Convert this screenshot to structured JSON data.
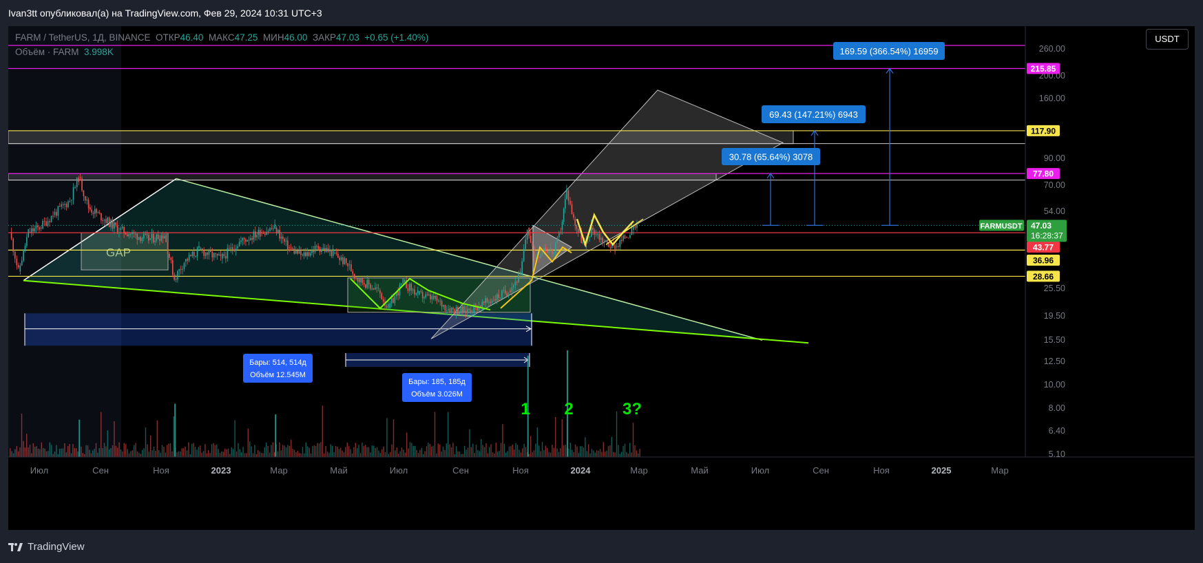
{
  "header": {
    "publish_info": "Ivan3tt опубликовал(а) на TradingView.com, Фев 29, 2024 10:31 UTC+3"
  },
  "legend": {
    "symbol_line": "FARM / TetherUS, 1Д, BINANCE",
    "open_label": "ОТКР",
    "open": "46.40",
    "high_label": "МАКС",
    "high": "47.25",
    "low_label": "МИН",
    "low": "46.00",
    "close_label": "ЗАКР",
    "close": "47.03",
    "change": "+0.65 (+1.40%)",
    "volume_label": "Объём · FARM",
    "volume": "3.998K"
  },
  "currency_button": "USDT",
  "footer": {
    "brand": "TradingView"
  },
  "colors": {
    "magenta": "#e91eeb",
    "yellow": "#f5e44a",
    "red": "#f23645",
    "green": "#26a69a",
    "blue_box": "#2962ff",
    "label_blue": "#1976d2",
    "lime": "#7cfc00",
    "annotation_green": "#00e600"
  },
  "chart_data": {
    "type": "candlestick",
    "symbol": "FARM / TetherUS",
    "interval": "1Д",
    "exchange": "BINANCE",
    "scale": "log",
    "ylim": [
      5.1,
      270
    ],
    "yticks": [
      "260.00",
      "200.00",
      "160.00",
      "90.00",
      "70.00",
      "54.00",
      "25.50",
      "19.50",
      "15.50",
      "12.50",
      "10.00",
      "8.00",
      "6.40",
      "5.10"
    ],
    "xticks": [
      "Июл",
      "Сен",
      "Ноя",
      "2023",
      "Мар",
      "Май",
      "Июл",
      "Сен",
      "Ноя",
      "2024",
      "Мар",
      "Май",
      "Июл",
      "Сен",
      "Ноя",
      "2025",
      "Мар"
    ],
    "price_path": [
      [
        "2022-06-01",
        44
      ],
      [
        "2022-06-10",
        30
      ],
      [
        "2022-06-20",
        44
      ],
      [
        "2022-07-01",
        46
      ],
      [
        "2022-07-15",
        52
      ],
      [
        "2022-08-01",
        60
      ],
      [
        "2022-08-10",
        75
      ],
      [
        "2022-08-20",
        56
      ],
      [
        "2022-09-05",
        50
      ],
      [
        "2022-09-20",
        45
      ],
      [
        "2022-10-05",
        43
      ],
      [
        "2022-10-20",
        41
      ],
      [
        "2022-11-05",
        43
      ],
      [
        "2022-11-15",
        28
      ],
      [
        "2022-11-25",
        33
      ],
      [
        "2022-12-10",
        37
      ],
      [
        "2023-01-01",
        34
      ],
      [
        "2023-01-20",
        40
      ],
      [
        "2023-02-10",
        44
      ],
      [
        "2023-02-25",
        46
      ],
      [
        "2023-03-10",
        38
      ],
      [
        "2023-03-25",
        35
      ],
      [
        "2023-04-10",
        38
      ],
      [
        "2023-04-25",
        36
      ],
      [
        "2023-05-10",
        32
      ],
      [
        "2023-05-20",
        28
      ],
      [
        "2023-06-10",
        25
      ],
      [
        "2023-06-20",
        21
      ],
      [
        "2023-07-05",
        27
      ],
      [
        "2023-07-20",
        24
      ],
      [
        "2023-08-05",
        23
      ],
      [
        "2023-08-20",
        21
      ],
      [
        "2023-09-05",
        20.5
      ],
      [
        "2023-09-20",
        21.5
      ],
      [
        "2023-10-05",
        23
      ],
      [
        "2023-10-20",
        25
      ],
      [
        "2023-11-01",
        29
      ],
      [
        "2023-11-08",
        46
      ],
      [
        "2023-11-15",
        34
      ],
      [
        "2023-11-25",
        38
      ],
      [
        "2023-12-05",
        36
      ],
      [
        "2023-12-12",
        45
      ],
      [
        "2023-12-18",
        66
      ],
      [
        "2023-12-25",
        50
      ],
      [
        "2024-01-05",
        38
      ],
      [
        "2024-01-12",
        46
      ],
      [
        "2024-01-25",
        40
      ],
      [
        "2024-02-05",
        38
      ],
      [
        "2024-02-15",
        42
      ],
      [
        "2024-02-22",
        45
      ],
      [
        "2024-02-29",
        47.03
      ]
    ],
    "volume_spikes_k": [
      [
        "2023-11-08",
        95
      ],
      [
        "2023-12-18",
        100
      ],
      [
        "2023-02-25",
        40
      ],
      [
        "2022-11-15",
        50
      ],
      [
        "2022-08-10",
        35
      ]
    ],
    "horizontal_levels": [
      {
        "price": 270,
        "color": "magenta"
      },
      {
        "price": 215.85,
        "label": "215.85",
        "color": "magenta"
      },
      {
        "price": 117.9,
        "label": "117.90",
        "color": "yellow"
      },
      {
        "price": 104,
        "color": "white"
      },
      {
        "price": 77.8,
        "label": "77.80",
        "color": "magenta"
      },
      {
        "price": 73,
        "color": "white"
      },
      {
        "price": 43.77,
        "label": "43.77",
        "color": "red"
      },
      {
        "price": 36.96,
        "label": "36.96",
        "color": "yellow"
      },
      {
        "price": 28.66,
        "label": "28.66",
        "color": "yellow"
      }
    ],
    "last_price": {
      "symbol": "FARMUSDT",
      "price": "47.03",
      "countdown": "16:28:37"
    },
    "measure_labels": [
      {
        "text": "169.59 (366.54%) 16959"
      },
      {
        "text": "69.43 (147.21%) 6943"
      },
      {
        "text": "30.78 (65.64%) 3078"
      }
    ],
    "range_labels": [
      {
        "bars": "Бары: 514, 514д",
        "volume": "Объём 12.545M"
      },
      {
        "bars": "Бары: 185, 185д",
        "volume": "Объём 3.026M"
      }
    ],
    "annotations": [
      "GAP",
      "1",
      "2",
      "3?"
    ]
  }
}
